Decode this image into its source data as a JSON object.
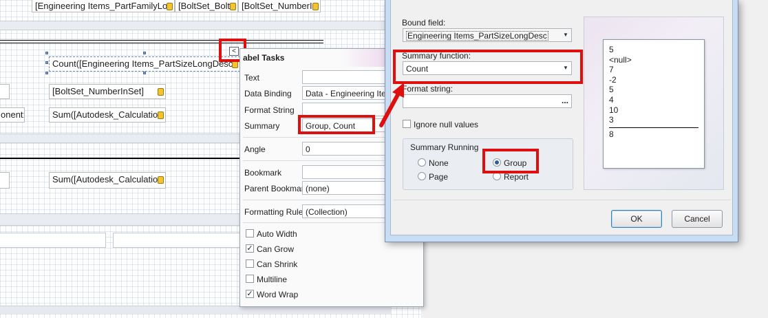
{
  "designer": {
    "top_fields": [
      "[Engineering Items_PartFamilyLo",
      "[BoltSet_BoltS",
      "[BoltSet_NumberI"
    ],
    "count_field": "Count([Engineering Items_PartSizeLongDesc",
    "number_field": "[BoltSet_NumberInSet]",
    "sum_field_1": "Sum([Autodesk_Calculatio",
    "sum_field_2": "Sum([Autodesk_Calculatio",
    "component_caption": "onent:",
    "smart_tag_glyph": "<"
  },
  "tasks": {
    "title": "abel Tasks",
    "rows": {
      "text": {
        "label": "Text",
        "value": ""
      },
      "binding": {
        "label": "Data Binding",
        "value": "Data - Engineering Items"
      },
      "format": {
        "label": "Format String",
        "value": ""
      },
      "summary": {
        "label": "Summary",
        "value": "Group, Count"
      },
      "angle": {
        "label": "Angle",
        "value": "0"
      },
      "bookmark": {
        "label": "Bookmark",
        "value": ""
      },
      "parent_bookmark": {
        "label": "Parent Bookmark",
        "value": "(none)"
      },
      "rules": {
        "label": "Formatting Rules",
        "value": "(Collection)"
      }
    },
    "checkboxes": [
      {
        "label": "Auto Width",
        "checked": false
      },
      {
        "label": "Can Grow",
        "checked": true
      },
      {
        "label": "Can Shrink",
        "checked": false
      },
      {
        "label": "Multiline",
        "checked": false
      },
      {
        "label": "Word Wrap",
        "checked": true
      }
    ]
  },
  "dialog": {
    "bound_field_label": "Bound field:",
    "bound_field_value": "Engineering Items_PartSizeLongDesc",
    "summary_function_label": "Summary function:",
    "summary_function_value": "Count",
    "format_string_label": "Format string:",
    "format_string_value": "",
    "ellipsis": "...",
    "ignore_nulls_label": "Ignore null values",
    "ignore_nulls_checked": false,
    "running_group_title": "Summary Running",
    "running_options": {
      "none": "None",
      "group": "Group",
      "page": "Page",
      "report": "Report"
    },
    "running_selected": "Group",
    "preview_values": [
      "5",
      "<null>",
      "7",
      "-2",
      "5",
      "4",
      "10",
      "3"
    ],
    "preview_result": "8",
    "ok_label": "OK",
    "cancel_label": "Cancel"
  },
  "colors": {
    "highlight": "#dd0f0f",
    "dialog_frame": "#c8dcf4"
  }
}
